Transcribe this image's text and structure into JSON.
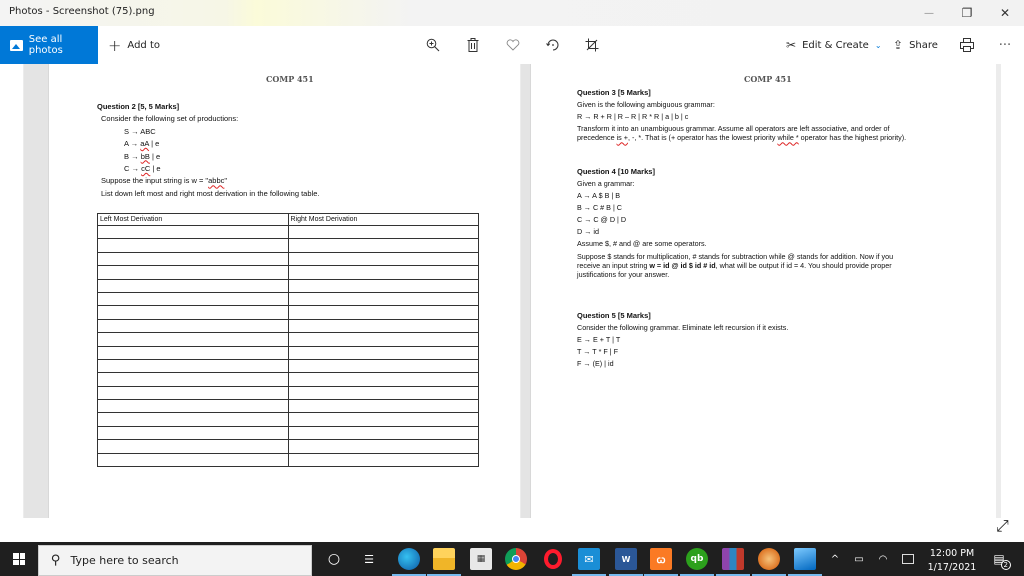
{
  "window": {
    "title": "Photos - Screenshot (75).png",
    "controls": {
      "minimize": "—",
      "maximize": "❐",
      "close": "✕"
    }
  },
  "toolbar": {
    "see_all_photos": "See all photos",
    "add_to": "Add to",
    "edit_create": "Edit & Create",
    "share": "Share",
    "more": "···",
    "icons": [
      "zoom-in-icon",
      "delete-icon",
      "favorite-icon",
      "rotate-icon",
      "crop-icon",
      "edit-create-icon",
      "share-icon",
      "print-icon",
      "more-icon"
    ]
  },
  "document": {
    "left_page": {
      "header": "COMP 451",
      "question_title": "Question 2 [5, 5 Marks]",
      "intro": "Consider the following set of productions:",
      "productions": [
        {
          "lhs": "S",
          "rhs_plain": "ABC",
          "rhs_squig": "",
          "rhs_tail": ""
        },
        {
          "lhs": "A",
          "rhs_plain": "",
          "rhs_squig": "aA",
          "rhs_tail": " | e"
        },
        {
          "lhs": "B",
          "rhs_plain": "",
          "rhs_squig": "bB",
          "rhs_tail": " | e"
        },
        {
          "lhs": "C",
          "rhs_plain": "",
          "rhs_squig": "cC",
          "rhs_tail": " | e"
        }
      ],
      "input_prefix": "Suppose the input string is w = \"",
      "input_value": "abbc",
      "input_suffix": "\"",
      "instruction": "List down left most and right most derivation in the following table.",
      "table": {
        "headers": [
          "Left Most Derivation",
          "Right Most Derivation"
        ],
        "empty_rows": 18
      }
    },
    "right_page": {
      "header": "COMP 451",
      "q3": {
        "title": "Question 3 [5 Marks]",
        "intro": "Given is the following ambiguous grammar:",
        "grammar": "R → R + R | R – R | R * R | a | b | c",
        "text1": "Transform it into an unambiguous grammar. Assume all operators are left associative, and order of",
        "text2_a": "precedence ",
        "text2_squig1": "is +",
        "text2_b": ", -, *. That is (+ operator has the lowest priority ",
        "text2_squig2": "while *",
        "text2_c": " operator has the highest priority)."
      },
      "q4": {
        "title": "Question 4 [10 Marks]",
        "intro": "Given a grammar:",
        "grammar": [
          "A → A $ B | B",
          "B → C # B | C",
          "C → C @ D | D",
          "D → id"
        ],
        "assume": "Assume $, # and @ are some operators.",
        "para1": "Suppose $ stands for multiplication, # stands for subtraction while @ stands for addition. Now if you",
        "para2_a": "receive an input string ",
        "para2_bold": "w = id @ id $ id # id",
        "para2_b": ", what will be output if id = 4. You should provide proper",
        "para3": "justifications for your answer."
      },
      "q5": {
        "title": "Question 5 [5 Marks]",
        "intro": "Consider the following grammar. Eliminate left recursion if it exists.",
        "grammar": [
          "E → E + T | T",
          "T → T * F | F",
          "F → (E) | id"
        ]
      }
    }
  },
  "taskbar": {
    "search_placeholder": "Type here to search",
    "apps": [
      "cortana",
      "task-view",
      "edge",
      "file-explorer",
      "microsoft-store",
      "chrome",
      "opera",
      "mail",
      "word",
      "xampp",
      "quickbooks",
      "winrar",
      "peach-app",
      "photos"
    ],
    "time": "12:00 PM",
    "date": "1/17/2021",
    "notification_count": "2"
  }
}
